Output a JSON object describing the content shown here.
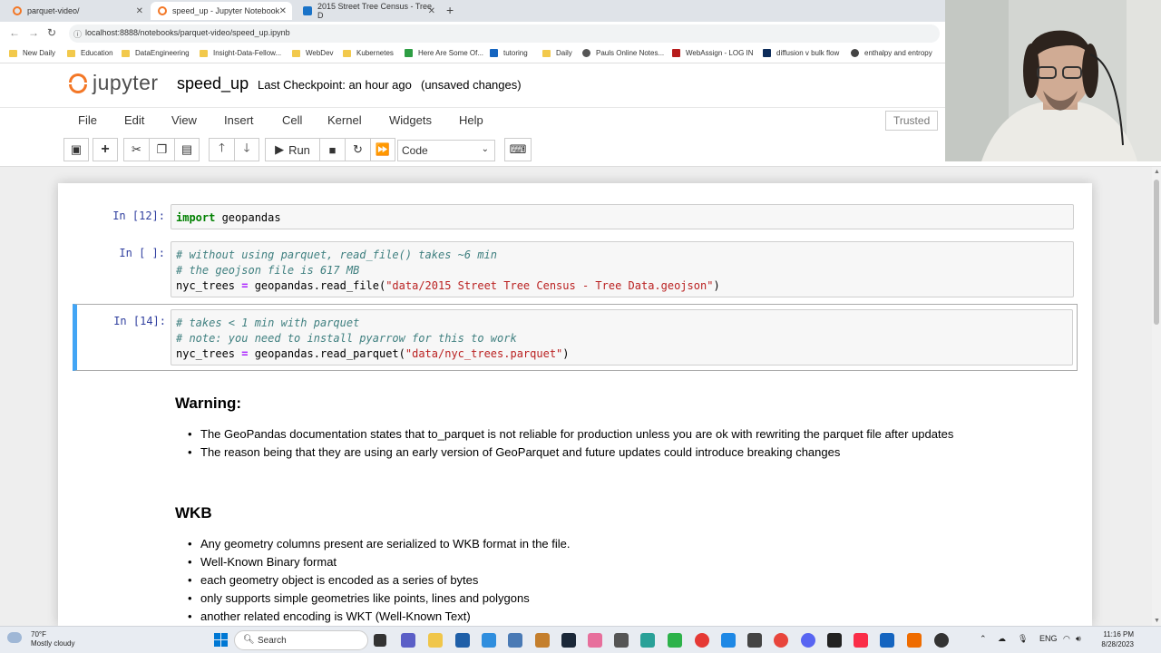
{
  "browser": {
    "tabs": [
      {
        "title": "parquet-video/",
        "active": false
      },
      {
        "title": "speed_up - Jupyter Notebook",
        "active": true
      },
      {
        "title": "2015 Street Tree Census - Tree D",
        "active": false
      }
    ],
    "new_tab": "+",
    "url": "localhost:8888/notebooks/parquet-video/speed_up.ipynb",
    "bookmarks": [
      "New Daily",
      "Education",
      "DataEngineering",
      "Insight-Data-Fellow...",
      "WebDev",
      "Kubernetes",
      "Here Are Some Of...",
      "tutoring",
      "Daily",
      "Pauls Online Notes...",
      "WebAssign - LOG IN",
      "diffusion v bulk flow",
      "enthalpy and entropy"
    ]
  },
  "jupyter": {
    "logo_text": "jupyter",
    "notebook_name": "speed_up",
    "checkpoint": "Last Checkpoint: an hour ago",
    "status": "(unsaved changes)",
    "menu": [
      "File",
      "Edit",
      "View",
      "Insert",
      "Cell",
      "Kernel",
      "Widgets",
      "Help"
    ],
    "trusted": "Trusted",
    "toolbar": {
      "run_label": "Run",
      "cell_type": "Code"
    }
  },
  "cells": [
    {
      "prompt": "In [12]:",
      "lines": [
        {
          "k": "import",
          "rest": " geopandas"
        }
      ]
    },
    {
      "prompt": "In [ ]:",
      "comment1": "# without using parquet, read_file() takes ~6 min",
      "comment2": "# the geojson file is 617 MB",
      "code_a": "nyc_trees ",
      "code_op": "=",
      "code_b": " geopandas.read_file(",
      "code_str": "\"data/2015 Street Tree Census - Tree Data.geojson\"",
      "code_c": ")"
    },
    {
      "prompt": "In [14]:",
      "comment1": "# takes < 1 min with parquet",
      "comment2": "# note: you need to install pyarrow for this to work",
      "code_a": "nyc_trees ",
      "code_op": "=",
      "code_b": " geopandas.read_parquet(",
      "code_str": "\"data/nyc_trees.parquet\"",
      "code_c": ")"
    }
  ],
  "markdown": {
    "warning_title": "Warning:",
    "warning_items": [
      "The GeoPandas documentation states that to_parquet is not reliable for production unless you are ok with rewriting the parquet file after updates",
      "The reason being that they are using an early version of GeoParquet and future updates could introduce breaking changes"
    ],
    "wkb_title": "WKB",
    "wkb_items": [
      "Any geometry columns present are serialized to WKB format in the file.",
      "Well-Known Binary format",
      "each geometry object is encoded as a series of bytes",
      "only supports simple geometries like points, lines and polygons",
      "another related encoding is WKT (Well-Known Text)"
    ]
  },
  "taskbar": {
    "temp": "70°F",
    "weather": "Mostly cloudy",
    "search": "Search",
    "lang": "ENG",
    "time": "11:16 PM",
    "date": "8/28/2023"
  }
}
